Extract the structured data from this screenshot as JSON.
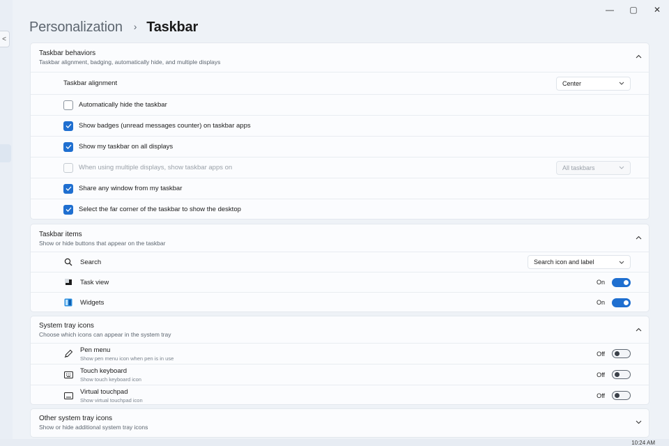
{
  "window": {
    "minimize_glyph": "—",
    "maximize_glyph": "▢",
    "close_glyph": "✕"
  },
  "nav": {
    "back_glyph": "<"
  },
  "breadcrumb": {
    "parent": "Personalization",
    "separator": "›",
    "current": "Taskbar"
  },
  "behaviors": {
    "title": "Taskbar behaviors",
    "subtitle": "Taskbar alignment, badging, automatically hide, and multiple displays",
    "alignment_label": "Taskbar alignment",
    "alignment_value": "Center",
    "checkboxes": [
      {
        "label": "Automatically hide the taskbar",
        "checked": false,
        "disabled": false
      },
      {
        "label": "Show badges (unread messages counter) on taskbar apps",
        "checked": true,
        "disabled": false
      },
      {
        "label": "Show my taskbar on all displays",
        "checked": true,
        "disabled": false
      },
      {
        "label": "When using multiple displays, show taskbar apps on",
        "checked": false,
        "disabled": true
      },
      {
        "label": "Share any window from my taskbar",
        "checked": true,
        "disabled": false
      },
      {
        "label": "Select the far corner of the taskbar to show the desktop",
        "checked": true,
        "disabled": false
      }
    ],
    "multi_display_value": "All taskbars"
  },
  "items": {
    "title": "Taskbar items",
    "subtitle": "Show or hide buttons that appear on the taskbar",
    "search_label": "Search",
    "search_value": "Search icon and label",
    "task_view_label": "Task view",
    "task_view_state": "On",
    "widgets_label": "Widgets",
    "widgets_state": "On"
  },
  "tray": {
    "title": "System tray icons",
    "subtitle": "Choose which icons can appear in the system tray",
    "pen_label": "Pen menu",
    "pen_sub": "Show pen menu icon when pen is in use",
    "pen_state": "Off",
    "keyboard_label": "Touch keyboard",
    "keyboard_sub": "Show touch keyboard icon",
    "keyboard_state": "Off",
    "touchpad_label": "Virtual touchpad",
    "touchpad_sub": "Show virtual touchpad icon",
    "touchpad_state": "Off"
  },
  "other_tray": {
    "title": "Other system tray icons",
    "subtitle": "Show or hide additional system tray icons"
  },
  "taskbar_clock": "10:24 AM",
  "colors": {
    "accent": "#1f6fd0",
    "background": "#eef2f7",
    "card": "#fbfcfe"
  },
  "icons": {
    "search": "search-icon",
    "task_view": "task-view-icon",
    "widgets": "widgets-icon",
    "pen": "pen-icon",
    "keyboard": "keyboard-icon",
    "touchpad": "touchpad-icon",
    "chevron_up": "chevron-up-icon",
    "chevron_down": "chevron-down-icon"
  }
}
